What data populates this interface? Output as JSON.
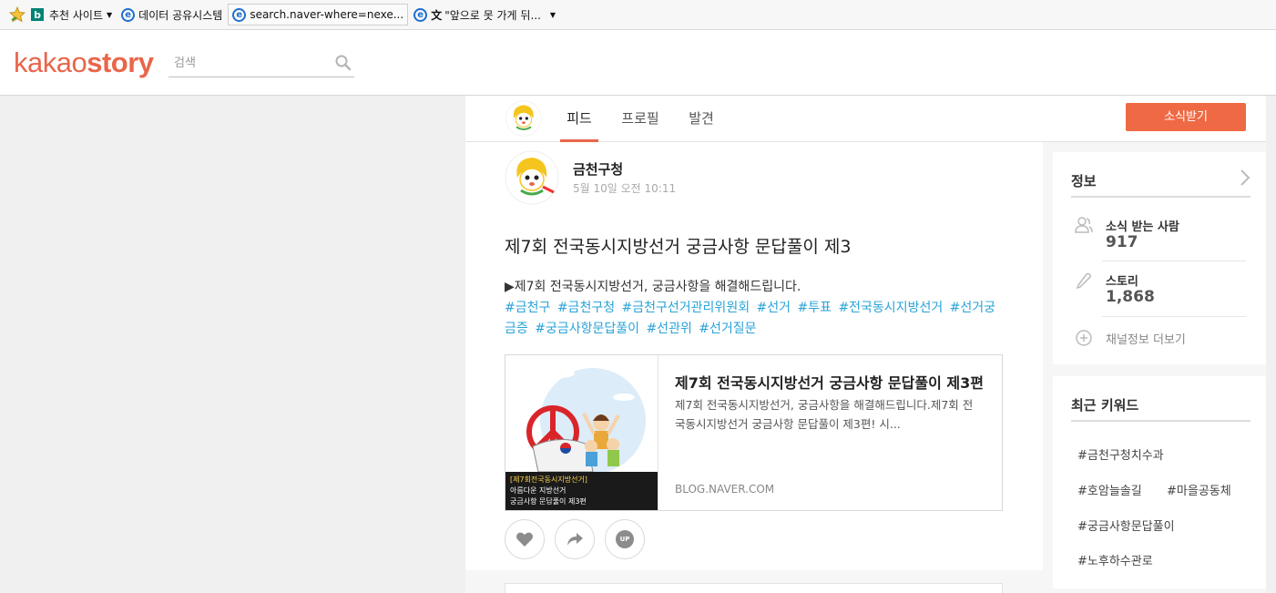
{
  "favbar": {
    "items": [
      {
        "label": "추천 사이트"
      },
      {
        "label": "데이터 공유시스템"
      },
      {
        "label": "search.naver-where=nexe..."
      },
      {
        "label": "\"앞으로 못 가게 뒤..."
      }
    ]
  },
  "header": {
    "logo_part1": "kakao",
    "logo_part2": "story",
    "search_placeholder": "검색"
  },
  "nav": {
    "tabs": [
      {
        "label": "피드",
        "active": true
      },
      {
        "label": "프로필",
        "active": false
      },
      {
        "label": "발견",
        "active": false
      }
    ],
    "subscribe_label": "소식받기"
  },
  "post": {
    "author": "금천구청",
    "time": "5월 10일 오전 10:11",
    "title": "제7회 전국동시지방선거 궁금사항 문답풀이 제3",
    "body": "▶제7회 전국동시지방선거, 궁금사항을 해결해드립니다.",
    "hashtags": [
      "#금천구",
      "#금천구청",
      "#금천구선거관리위원회",
      "#선거",
      "#투표",
      "#전국동시지방선거",
      "#선거궁금증",
      "#궁금사항문답풀이",
      "#선관위",
      "#선거질문"
    ],
    "link": {
      "title": "제7회 전국동시지방선거 궁금사항 문답풀이 제3편",
      "description": "제7회 전국동시지방선거, 궁금사항을 해결해드립니다.제7회 전국동시지방선거 궁금사항 문답풀이 제3편! 시...",
      "domain": "BLOG.NAVER.COM",
      "thumb_caption_1": "[제7회전국동시지방선거]",
      "thumb_caption_2": "아름다운 지방선거",
      "thumb_caption_3": "궁금사항 문답풀이 제3편"
    },
    "actions": [
      {
        "icon": "heart-icon"
      },
      {
        "icon": "share-icon"
      },
      {
        "icon": "up-icon",
        "label": "UP"
      }
    ]
  },
  "info_panel": {
    "title": "정보",
    "subscribers_label": "소식 받는 사람",
    "subscribers_value": "917",
    "stories_label": "스토리",
    "stories_value": "1,868",
    "more_label": "채널정보 더보기"
  },
  "keyword_panel": {
    "title": "최근 키워드",
    "keywords": [
      "#금천구청치수과",
      "#호암늘솔길",
      "#마을공동체",
      "#궁금사항문답풀이",
      "#노후하수관로"
    ]
  },
  "colors": {
    "brand": "#e9664a",
    "subscribe_button": "#ef6a44",
    "hashtag": "#29a3d8"
  }
}
